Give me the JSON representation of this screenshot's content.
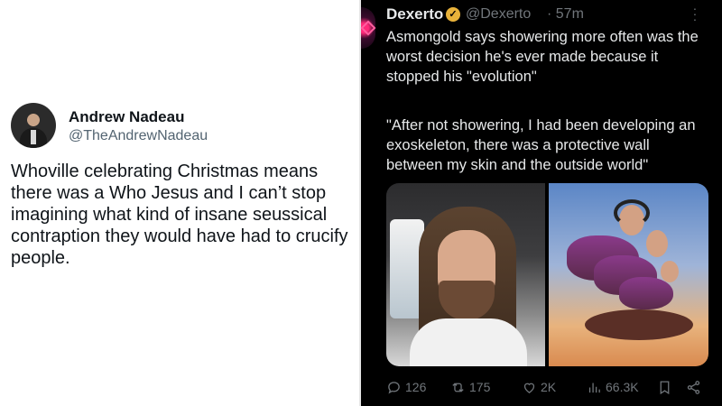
{
  "left_tweet": {
    "name": "Andrew Nadeau",
    "handle": "@TheAndrewNadeau",
    "text": "Whoville celebrating Christmas means there was a Who Jesus and I can’t stop imagining what kind of insane seussical contraption they would have had to crucify people."
  },
  "right_tweet": {
    "name": "Dexerto",
    "handle": "@Dexerto",
    "time": "· 57m",
    "text_1": "Asmongold says showering more often was the worst decision he's ever made because it stopped his \"evolution\"",
    "text_2": "\"After not showering, I had been developing an exoskeleton, there was a protective wall between my skin and the outside world\"",
    "actions": {
      "replies": "126",
      "reposts": "175",
      "likes": "2K",
      "views": "66.3K"
    }
  },
  "icons": [
    "verified-badge-icon",
    "more-icon",
    "reply-icon",
    "repost-icon",
    "like-icon",
    "views-icon",
    "bookmark-icon",
    "share-icon"
  ],
  "colors": {
    "dark_bg": "#000000",
    "light_bg": "#ffffff",
    "muted_text": "#71767b",
    "badge_gold": "#e8b23a"
  }
}
